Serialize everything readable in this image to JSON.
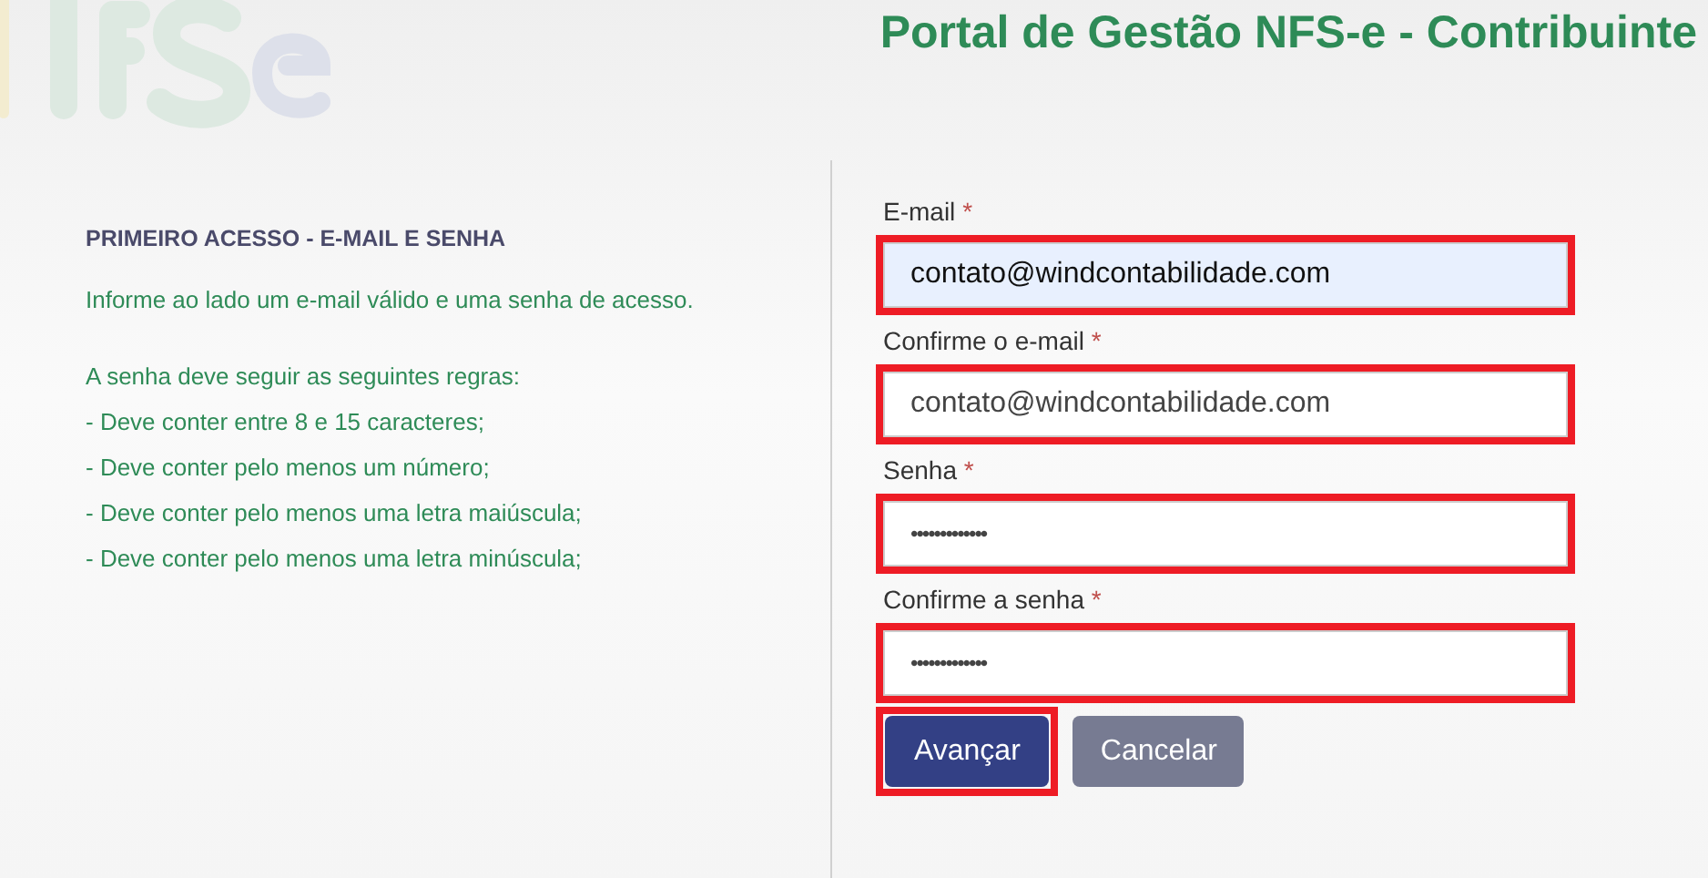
{
  "header": {
    "title": "Portal de Gestão NFS-e - Contribuinte"
  },
  "info": {
    "heading": "PRIMEIRO ACESSO - E-MAIL E SENHA",
    "intro": "Informe ao lado um e-mail válido e uma senha de acesso.",
    "rules_title": "A senha deve seguir as seguintes regras:",
    "rules": [
      "- Deve conter entre 8 e 15 caracteres;",
      "- Deve conter pelo menos um número;",
      "- Deve conter pelo menos uma letra maiúscula;",
      "- Deve conter pelo menos uma letra minúscula;"
    ]
  },
  "fields": [
    {
      "label": "E-mail",
      "required_mark": "*",
      "value": "contato@windcontabilidade.com",
      "kind": "text",
      "autofilled": true,
      "highlighted": true
    },
    {
      "label": "Confirme o e-mail",
      "required_mark": "*",
      "value": "contato@windcontabilidade.com",
      "kind": "text",
      "autofilled": false,
      "highlighted": true
    },
    {
      "label": "Senha",
      "required_mark": "*",
      "value": "•••••••••••••",
      "kind": "password",
      "autofilled": false,
      "highlighted": true
    },
    {
      "label": "Confirme a senha",
      "required_mark": "*",
      "value": "•••••••••••••",
      "kind": "password",
      "autofilled": false,
      "highlighted": true
    }
  ],
  "buttons": [
    {
      "label": "Avançar",
      "kind": "primary",
      "highlighted": true
    },
    {
      "label": "Cancelar",
      "kind": "secondary",
      "highlighted": false
    }
  ]
}
